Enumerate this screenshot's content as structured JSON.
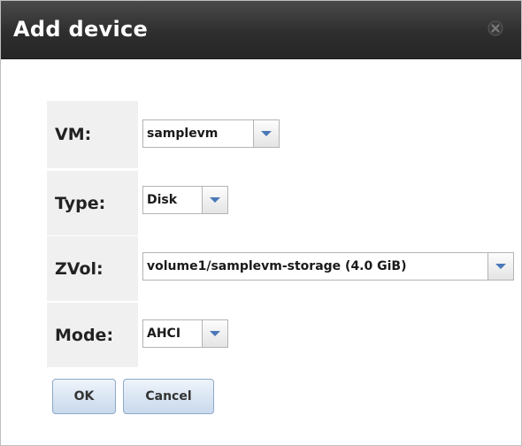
{
  "dialog": {
    "title": "Add device"
  },
  "form": {
    "vm": {
      "label": "VM:",
      "value": "samplevm"
    },
    "type": {
      "label": "Type:",
      "value": "Disk"
    },
    "zvol": {
      "label": "ZVol:",
      "value": "volume1/samplevm-storage (4.0 GiB)"
    },
    "mode": {
      "label": "Mode:",
      "value": "AHCI"
    }
  },
  "buttons": {
    "ok": "OK",
    "cancel": "Cancel"
  },
  "icons": {
    "close": "close-icon",
    "dropdown": "chevron-down-icon"
  },
  "colors": {
    "titlebar": "#2e2e2e",
    "label_bg": "#f0f0f0",
    "arrow": "#4a78b8",
    "button_bg": "#c9d9ec"
  }
}
